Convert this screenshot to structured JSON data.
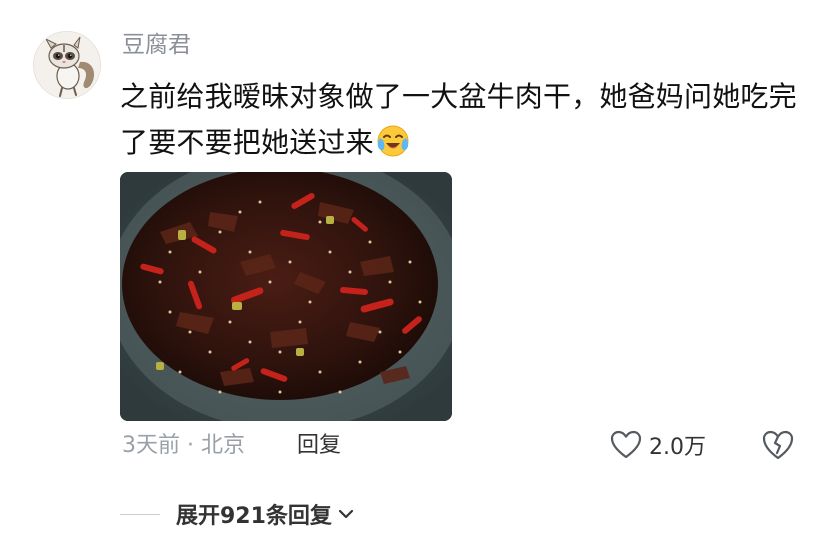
{
  "comment": {
    "username": "豆腐君",
    "text": "之前给我暧昧对象做了一大盆牛肉干，她爸妈问她吃完了要不要把她送过来",
    "time_location": "3天前 · 北京",
    "reply_label": "回复",
    "like_count": "2.0万",
    "expand_label": "展开921条回复",
    "emoji": "crying-laughing-emoji",
    "colors": {
      "username": "#8a8f99",
      "text": "#111111",
      "meta": "#9aa0a8",
      "action": "#333333"
    }
  }
}
